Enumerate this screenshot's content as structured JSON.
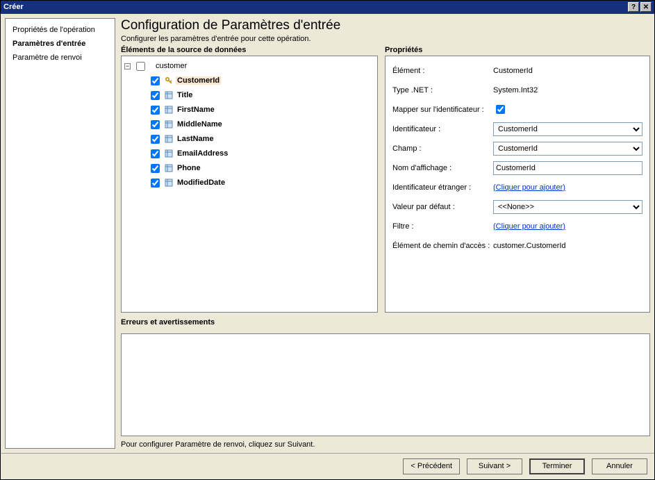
{
  "window": {
    "title": "Créer"
  },
  "sidebar": {
    "items": [
      {
        "label": "Propriétés de l'opération",
        "active": false
      },
      {
        "label": "Paramètres d'entrée",
        "active": true
      },
      {
        "label": "Paramètre de renvoi",
        "active": false
      }
    ]
  },
  "page": {
    "title": "Configuration de Paramètres d'entrée",
    "subtitle": "Configurer les paramètres d'entrée pour cette opération."
  },
  "tree": {
    "header": "Éléments de la source de données",
    "root": {
      "label": "customer",
      "checked": false
    },
    "items": [
      {
        "label": "CustomerId",
        "checked": true,
        "key": true,
        "selected": true
      },
      {
        "label": "Title",
        "checked": true,
        "key": false
      },
      {
        "label": "FirstName",
        "checked": true,
        "key": false
      },
      {
        "label": "MiddleName",
        "checked": true,
        "key": false
      },
      {
        "label": "LastName",
        "checked": true,
        "key": false
      },
      {
        "label": "EmailAddress",
        "checked": true,
        "key": false
      },
      {
        "label": "Phone",
        "checked": true,
        "key": false
      },
      {
        "label": "ModifiedDate",
        "checked": true,
        "key": false
      }
    ]
  },
  "properties": {
    "header": "Propriétés",
    "rows": {
      "element": {
        "label": "Élément :",
        "value": "CustomerId"
      },
      "netType": {
        "label": "Type .NET :",
        "value": "System.Int32"
      },
      "mapToId": {
        "label": "Mapper sur l'identificateur :",
        "checked": true
      },
      "identifier": {
        "label": "Identificateur :",
        "value": "CustomerId"
      },
      "field": {
        "label": "Champ :",
        "value": "CustomerId"
      },
      "displayName": {
        "label": "Nom d'affichage :",
        "value": "CustomerId"
      },
      "foreignId": {
        "label": "Identificateur étranger :",
        "link": "(Cliquer pour ajouter)"
      },
      "defaultValue": {
        "label": "Valeur par défaut :",
        "value": "<<None>>"
      },
      "filter": {
        "label": "Filtre :",
        "link": "(Cliquer pour ajouter)"
      },
      "accessPath": {
        "label": "Élément de chemin d'accès :",
        "value": "customer.CustomerId"
      }
    }
  },
  "errors": {
    "header": "Erreurs et avertissements"
  },
  "hint": "Pour configurer Paramètre de renvoi, cliquez sur Suivant.",
  "footer": {
    "back": "< Précédent",
    "next": "Suivant >",
    "finish": "Terminer",
    "cancel": "Annuler"
  }
}
